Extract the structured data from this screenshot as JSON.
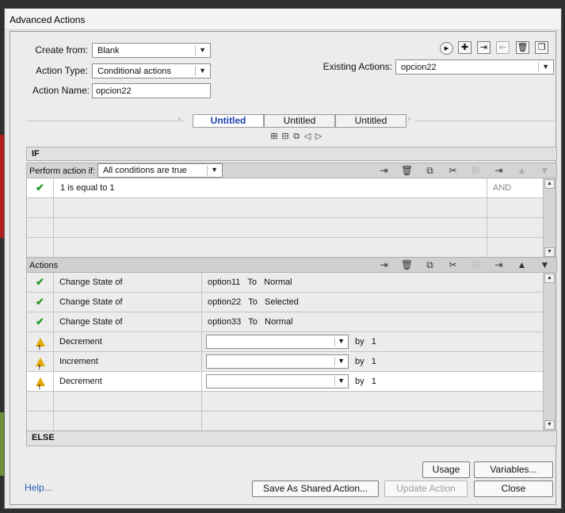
{
  "window": {
    "title": "Advanced Actions"
  },
  "form": {
    "create_from_label": "Create from:",
    "create_from_value": "Blank",
    "action_type_label": "Action Type:",
    "action_type_value": "Conditional actions",
    "action_name_label": "Action Name:",
    "action_name_value": "opcion22",
    "existing_actions_label": "Existing Actions:",
    "existing_actions_value": "opcion22"
  },
  "toolbar_icons": [
    "play-icon",
    "add-icon",
    "import-icon",
    "export-icon",
    "delete-icon",
    "duplicate-icon"
  ],
  "tabs": [
    {
      "label": "Untitled",
      "active": true
    },
    {
      "label": "Untitled",
      "active": false
    },
    {
      "label": "Untitled",
      "active": false
    }
  ],
  "if_section": {
    "header": "IF",
    "perform_label": "Perform action if:",
    "perform_value": "All conditions are true",
    "conditions": [
      {
        "status": "ok",
        "text": "1   is equal to   1",
        "join": "AND"
      }
    ]
  },
  "actions_section": {
    "header": "Actions",
    "rows": [
      {
        "status": "ok",
        "action": "Change State of",
        "target": "option11",
        "to": "To",
        "state": "Normal"
      },
      {
        "status": "ok",
        "action": "Change State of",
        "target": "option22",
        "to": "To",
        "state": "Selected"
      },
      {
        "status": "ok",
        "action": "Change State of",
        "target": "option33",
        "to": "To",
        "state": "Normal"
      },
      {
        "status": "warn",
        "action": "Decrement",
        "by": "by",
        "amount": "1"
      },
      {
        "status": "warn",
        "action": "Increment",
        "by": "by",
        "amount": "1"
      },
      {
        "status": "warn",
        "action": "Decrement",
        "by": "by",
        "amount": "1"
      }
    ]
  },
  "else_section": {
    "header": "ELSE"
  },
  "buttons": {
    "usage": "Usage",
    "variables": "Variables...",
    "help": "Help...",
    "save_shared": "Save As Shared Action...",
    "update": "Update Action",
    "close": "Close"
  }
}
